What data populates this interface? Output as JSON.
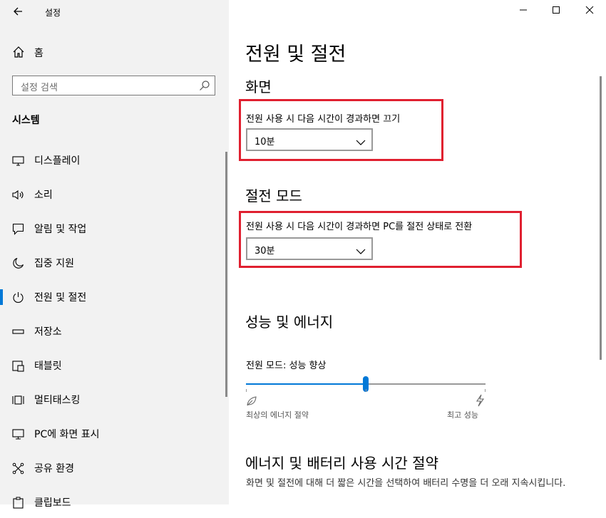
{
  "window": {
    "title": "설정",
    "back_icon": "back-arrow-icon",
    "controls": [
      "minimize-icon",
      "maximize-icon",
      "close-icon"
    ]
  },
  "sidebar": {
    "home_label": "홈",
    "search_placeholder": "설정 검색",
    "section_label": "시스템",
    "items": [
      {
        "label": "디스플레이",
        "icon": "monitor-icon"
      },
      {
        "label": "소리",
        "icon": "speaker-icon"
      },
      {
        "label": "알림 및 작업",
        "icon": "notification-icon"
      },
      {
        "label": "집중 지원",
        "icon": "moon-icon"
      },
      {
        "label": "전원 및 절전",
        "icon": "power-icon",
        "selected": true
      },
      {
        "label": "저장소",
        "icon": "storage-icon"
      },
      {
        "label": "태블릿",
        "icon": "tablet-icon"
      },
      {
        "label": "멀티태스킹",
        "icon": "multitasking-icon"
      },
      {
        "label": "PC에 화면 표시",
        "icon": "project-icon"
      },
      {
        "label": "공유 환경",
        "icon": "share-icon"
      },
      {
        "label": "클립보드",
        "icon": "clipboard-icon"
      }
    ]
  },
  "main": {
    "title": "전원 및 절전",
    "screen": {
      "heading": "화면",
      "setting_label": "전원 사용 시 다음 시간이 경과하면 끄기",
      "value": "10분"
    },
    "sleep": {
      "heading": "절전 모드",
      "setting_label": "전원 사용 시 다음 시간이 경과하면 PC를 절전 상태로 전환",
      "value": "30분"
    },
    "performance": {
      "heading": "성능 및 에너지",
      "mode_label": "전원 모드: 성능 향상",
      "slider_level": 0.5,
      "min_label": "최상의 에너지 절약",
      "max_label": "최고 성능"
    },
    "energy": {
      "heading": "에너지 및 배터리 사용 시간 절약",
      "description": "화면 및 절전에 대해 더 짧은 시간을 선택하여 배터리 수명을 더 오래 지속시킵니다."
    }
  },
  "colors": {
    "accent": "#0078d7",
    "highlight_box": "#e02030",
    "sidebar_bg": "#f2f2f2"
  }
}
